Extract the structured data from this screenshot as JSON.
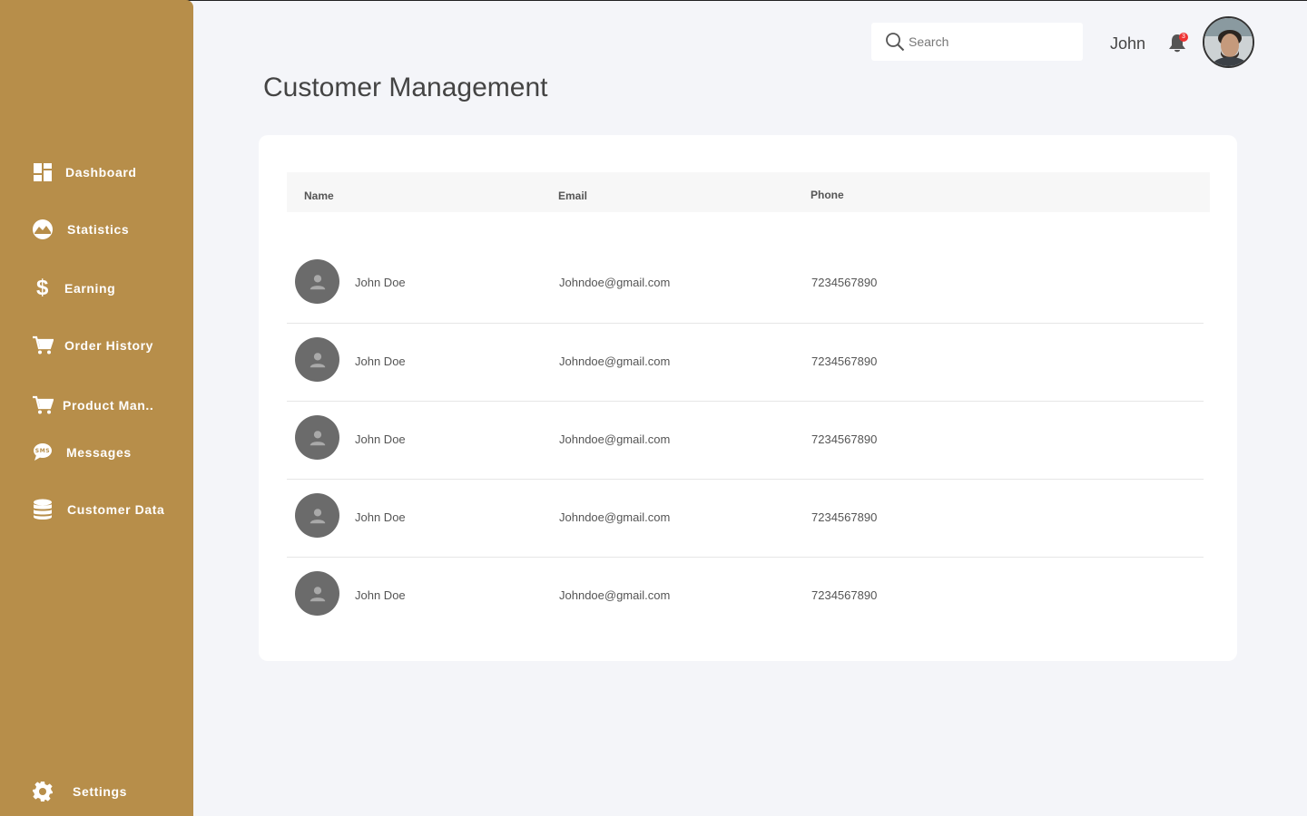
{
  "sidebar": {
    "color": "#b78e4a",
    "items": [
      {
        "label": "Dashboard",
        "icon": "dashboard-icon"
      },
      {
        "label": "Statistics",
        "icon": "statistics-icon"
      },
      {
        "label": "Earning",
        "icon": "dollar-icon"
      },
      {
        "label": "Order History",
        "icon": "cart-icon"
      },
      {
        "label": "Product Man..",
        "icon": "cart-icon"
      },
      {
        "label": "Messages",
        "icon": "sms-icon"
      },
      {
        "label": "Customer Data",
        "icon": "database-icon"
      }
    ],
    "settings": {
      "label": "Settings",
      "icon": "gear-icon"
    }
  },
  "header": {
    "search_placeholder": "Search",
    "username": "John",
    "notification_count": "3"
  },
  "main": {
    "title": "Customer Management",
    "table": {
      "columns": [
        "Name",
        "Email",
        "Phone"
      ],
      "rows": [
        {
          "name": "John Doe",
          "email": "Johndoe@gmail.com",
          "phone": "7234567890"
        },
        {
          "name": "John Doe",
          "email": "Johndoe@gmail.com",
          "phone": "7234567890"
        },
        {
          "name": "John Doe",
          "email": "Johndoe@gmail.com",
          "phone": "7234567890"
        },
        {
          "name": "John Doe",
          "email": "Johndoe@gmail.com",
          "phone": "7234567890"
        },
        {
          "name": "John Doe",
          "email": "Johndoe@gmail.com",
          "phone": "7234567890"
        }
      ]
    }
  }
}
